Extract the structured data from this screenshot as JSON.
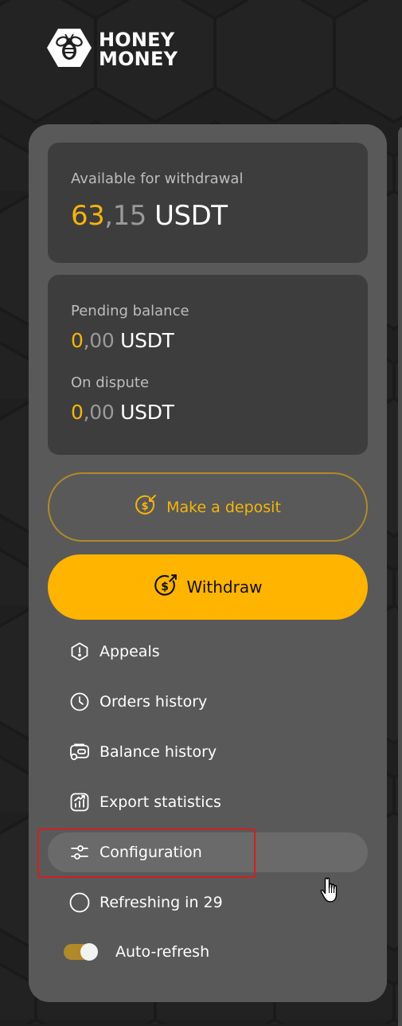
{
  "brand": {
    "line1": "HONEY",
    "line2": "MONEY",
    "logo_icon": "bee-hexagon-icon"
  },
  "available": {
    "label": "Available for withdrawal",
    "integer": "63",
    "separator": ",",
    "decimals": "15",
    "currency": "USDT"
  },
  "pending": {
    "label": "Pending balance",
    "integer": "0",
    "separator": ",",
    "decimals": "00",
    "currency": "USDT"
  },
  "dispute": {
    "label": "On dispute",
    "integer": "0",
    "separator": ",",
    "decimals": "00",
    "currency": "USDT"
  },
  "buttons": {
    "deposit": {
      "label": "Make a deposit",
      "icon": "dollar-in-icon"
    },
    "withdraw": {
      "label": "Withdraw",
      "icon": "dollar-out-icon"
    }
  },
  "menu": [
    {
      "label": "Appeals",
      "icon": "alert-hexagon-icon"
    },
    {
      "label": "Orders history",
      "icon": "clock-icon"
    },
    {
      "label": "Balance history",
      "icon": "wallet-icon"
    },
    {
      "label": "Export statistics",
      "icon": "chart-icon"
    },
    {
      "label": "Configuration",
      "icon": "sliders-icon",
      "active": true
    },
    {
      "label": "Refreshing in 29",
      "icon": "circle-icon"
    }
  ],
  "auto_refresh": {
    "label": "Auto-refresh",
    "enabled": true
  },
  "colors": {
    "accent": "#ffb400",
    "panel": "#595959",
    "card": "#3d3d3d",
    "highlight": "#d11f1f"
  }
}
